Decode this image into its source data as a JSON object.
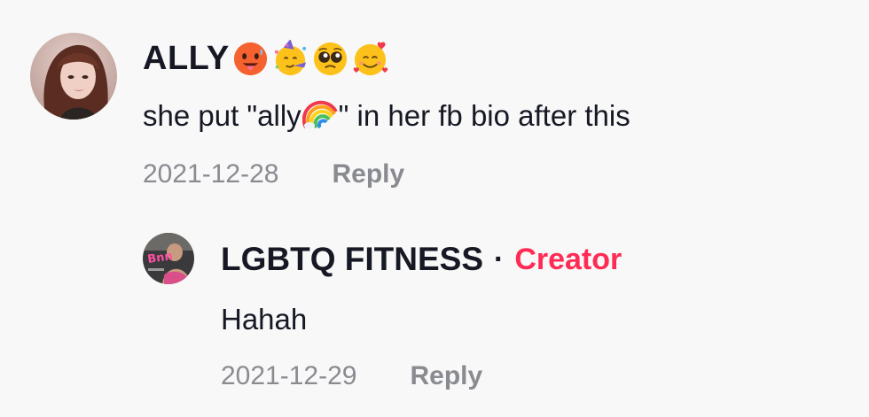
{
  "comment": {
    "username": "ALLY",
    "name_emojis": [
      "hot-face-emoji",
      "partying-face-emoji",
      "pleading-face-emoji",
      "smiling-face-with-hearts-emoji"
    ],
    "text_before": "she put \"ally",
    "text_after": "\" in her fb bio after this",
    "inline_emoji": "rainbow-emoji",
    "date": "2021-12-28",
    "reply_label": "Reply"
  },
  "reply": {
    "username": "LGBTQ FITNESS",
    "separator": "·",
    "badge": "Creator",
    "text": "Hahah",
    "date": "2021-12-29",
    "reply_label": "Reply"
  },
  "colors": {
    "background": "#f8f8f8",
    "text_primary": "#161823",
    "text_secondary": "#8a8b91",
    "creator_accent": "#fe2c55"
  }
}
